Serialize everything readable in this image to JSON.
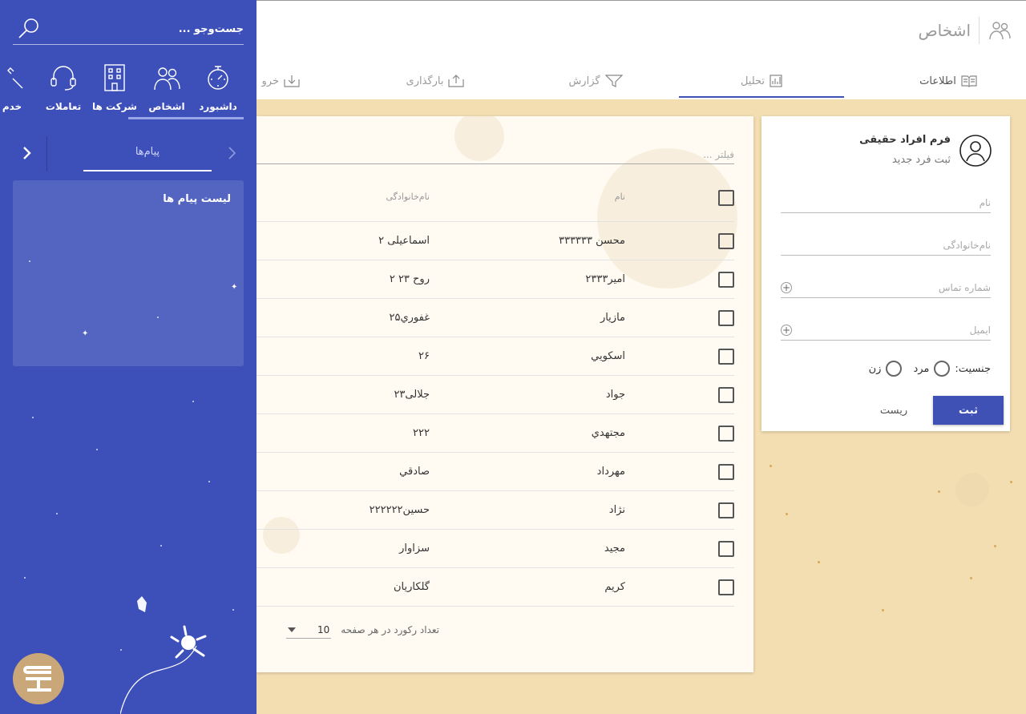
{
  "header": {
    "title": "اشخاص",
    "tabs": [
      {
        "label": "اطلاعات",
        "icon": "book-icon"
      },
      {
        "label": "تحلیل",
        "icon": "chart-icon"
      },
      {
        "label": "گزارش",
        "icon": "filter-icon"
      },
      {
        "label": "بارگذاری",
        "icon": "upload-icon"
      },
      {
        "label": "خرو",
        "icon": "download-icon"
      }
    ]
  },
  "form": {
    "title": "فرم افراد حقیقی",
    "subtitle": "ثبت فرد جدید",
    "first_name_placeholder": "نام",
    "last_name_placeholder": "نام‌خانوادگی",
    "phone_placeholder": "شماره تماس",
    "email_placeholder": "ایمیل",
    "gender_label": "جنسیت:",
    "gender_male": "مرد",
    "gender_female": "زن",
    "submit_label": "ثبت",
    "reset_label": "ریست"
  },
  "list": {
    "filter_placeholder": "فیلتر ...",
    "columns": {
      "name": "نام",
      "family": "نام‌خانوادگی"
    },
    "rows": [
      {
        "name": "محسن ۳۳۳۳۳۳",
        "family": "اسماعیلی ۲"
      },
      {
        "name": "امیر۲۳۳۳",
        "family": "روح ۲۳ ۲"
      },
      {
        "name": "مازیار",
        "family": "غفوري۲۵"
      },
      {
        "name": "اسكويي",
        "family": "۲۶"
      },
      {
        "name": "جواد",
        "family": "جلالی۲۳"
      },
      {
        "name": "مجتهدي",
        "family": "۲۲۲"
      },
      {
        "name": "مهرداد",
        "family": "صادقي"
      },
      {
        "name": "نژاد",
        "family": "حسین۲۲۲۲۲۲"
      },
      {
        "name": "مجید",
        "family": "سزاوار"
      },
      {
        "name": "كريم",
        "family": "گلكاريان"
      }
    ],
    "page_size_label": "تعداد رکورد در هر صفحه",
    "page_size_value": "10"
  },
  "sidebar": {
    "search_placeholder": "جست‌وجو ...",
    "nav": [
      {
        "label": "داشبورد",
        "icon": "dashboard-icon"
      },
      {
        "label": "اشخاص",
        "icon": "people-icon"
      },
      {
        "label": "شرکت ها",
        "icon": "building-icon"
      },
      {
        "label": "تعاملات",
        "icon": "headset-icon"
      },
      {
        "label": "خدم",
        "icon": "tools-icon"
      }
    ],
    "messages_tab": "پیام‌ها",
    "messages_title": "لیست پیام ها"
  },
  "colors": {
    "primary": "#3f51b5",
    "sidebar": "#3d4fb9",
    "background": "#f3deb1"
  }
}
